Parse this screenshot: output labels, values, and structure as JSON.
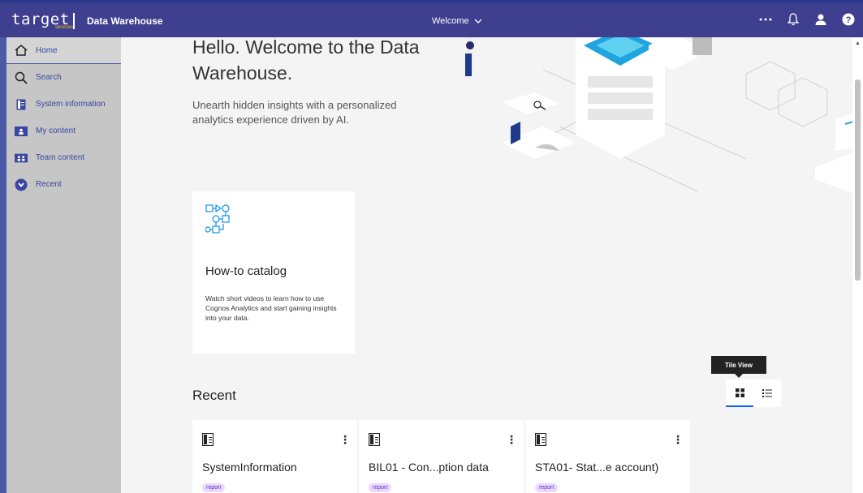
{
  "topbar": {
    "logo": "target",
    "logo_sub": "services",
    "app_title": "Data Warehouse",
    "center_label": "Welcome",
    "icons": [
      "more-icon",
      "bell-icon",
      "user-icon",
      "help-icon"
    ]
  },
  "sidebar": {
    "items": [
      {
        "label": "Home",
        "icon": "home-icon"
      },
      {
        "label": "Search",
        "icon": "search-icon"
      },
      {
        "label": "System information",
        "icon": "document-icon"
      },
      {
        "label": "My content",
        "icon": "folder-user-icon"
      },
      {
        "label": "Team content",
        "icon": "folder-team-icon"
      },
      {
        "label": "Recent",
        "icon": "recent-icon"
      }
    ]
  },
  "main": {
    "hero_title": "Hello. Welcome to the Data Warehouse.",
    "hero_subtitle": "Unearth hidden insights with a personalized analytics experience driven by AI.",
    "howto": {
      "title": "How-to catalog",
      "description": "Watch short videos to learn how to use Cognos Analytics and start gaining insights into your data."
    },
    "recent_title": "Recent",
    "tooltip": "Tile View",
    "tiles": [
      {
        "name": "SystemInformation",
        "tag": "report"
      },
      {
        "name": "BIL01 - Con...ption data",
        "tag": "report"
      },
      {
        "name": "STA01- Stat...e account)",
        "tag": "report"
      }
    ]
  },
  "colors": {
    "topbar": "#3f3f8f",
    "sidebar": "#c6c6c6",
    "accent": "#3a46a0",
    "tag_bg": "#e8daff"
  }
}
